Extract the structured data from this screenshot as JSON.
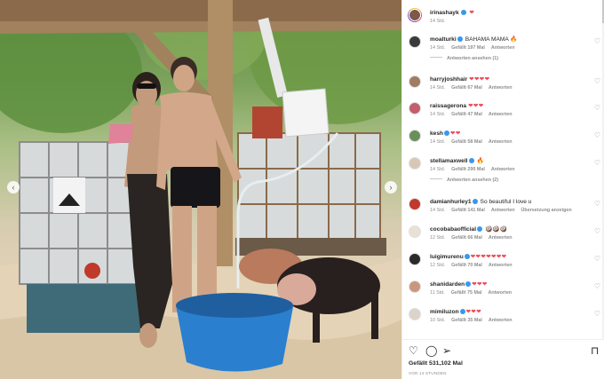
{
  "post": {
    "author": "irinashayk",
    "caption_hearts": "❤",
    "time": "14 Std."
  },
  "comments": [
    {
      "user": "moalturki",
      "verified": true,
      "text": "BAHAMA MAMA 🔥",
      "time": "14 Std.",
      "likes": "Gefällt 197 Mal",
      "reply": "Antworten",
      "replies_label": "Antworten ansehen (1)"
    },
    {
      "user": "harryjoshhair",
      "verified": false,
      "text": "❤❤❤❤",
      "time": "14 Std.",
      "likes": "Gefällt 67 Mal",
      "reply": "Antworten"
    },
    {
      "user": "raissagerona",
      "verified": false,
      "text": "❤❤❤",
      "time": "14 Std.",
      "likes": "Gefällt 47 Mal",
      "reply": "Antworten"
    },
    {
      "user": "kesh",
      "verified": true,
      "text": "❤❤",
      "time": "14 Std.",
      "likes": "Gefällt 58 Mal",
      "reply": "Antworten"
    },
    {
      "user": "stellamaxwell",
      "verified": true,
      "text": "🔥",
      "time": "14 Std.",
      "likes": "Gefällt 290 Mal",
      "reply": "Antworten",
      "replies_label": "Antworten ansehen (2)"
    },
    {
      "user": "damianhurley1",
      "verified": true,
      "text": "So beautiful I love u",
      "time": "14 Std.",
      "likes": "Gefällt 141 Mal",
      "reply": "Antworten",
      "translate": "Übersetzung anzeigen"
    },
    {
      "user": "cocobabaofficial",
      "verified": true,
      "text": "🥥🥥🥥",
      "time": "12 Std.",
      "likes": "Gefällt 66 Mal",
      "reply": "Antworten"
    },
    {
      "user": "luigimurenu",
      "verified": true,
      "text": "❤❤❤❤❤❤❤",
      "time": "12 Std.",
      "likes": "Gefällt 70 Mal",
      "reply": "Antworten"
    },
    {
      "user": "shanidarden",
      "verified": true,
      "text": "❤❤❤",
      "time": "11 Std.",
      "likes": "Gefällt 75 Mal",
      "reply": "Antworten"
    },
    {
      "user": "mimiluzon",
      "verified": true,
      "text": "❤❤❤",
      "time": "10 Std.",
      "likes": "Gefällt 35 Mal",
      "reply": "Antworten"
    }
  ],
  "actions": {
    "like_icon": "heart-icon",
    "comment_icon": "comment-icon",
    "share_icon": "send-icon",
    "save_icon": "bookmark-icon"
  },
  "likes_total": "Gefällt 531,102 Mal",
  "time_ago": "VOR 14 STUNDEN",
  "colors": {
    "heart_red": "#ed4956",
    "verified_blue": "#3897f0",
    "muted": "#8e8e8e",
    "text": "#262626"
  }
}
